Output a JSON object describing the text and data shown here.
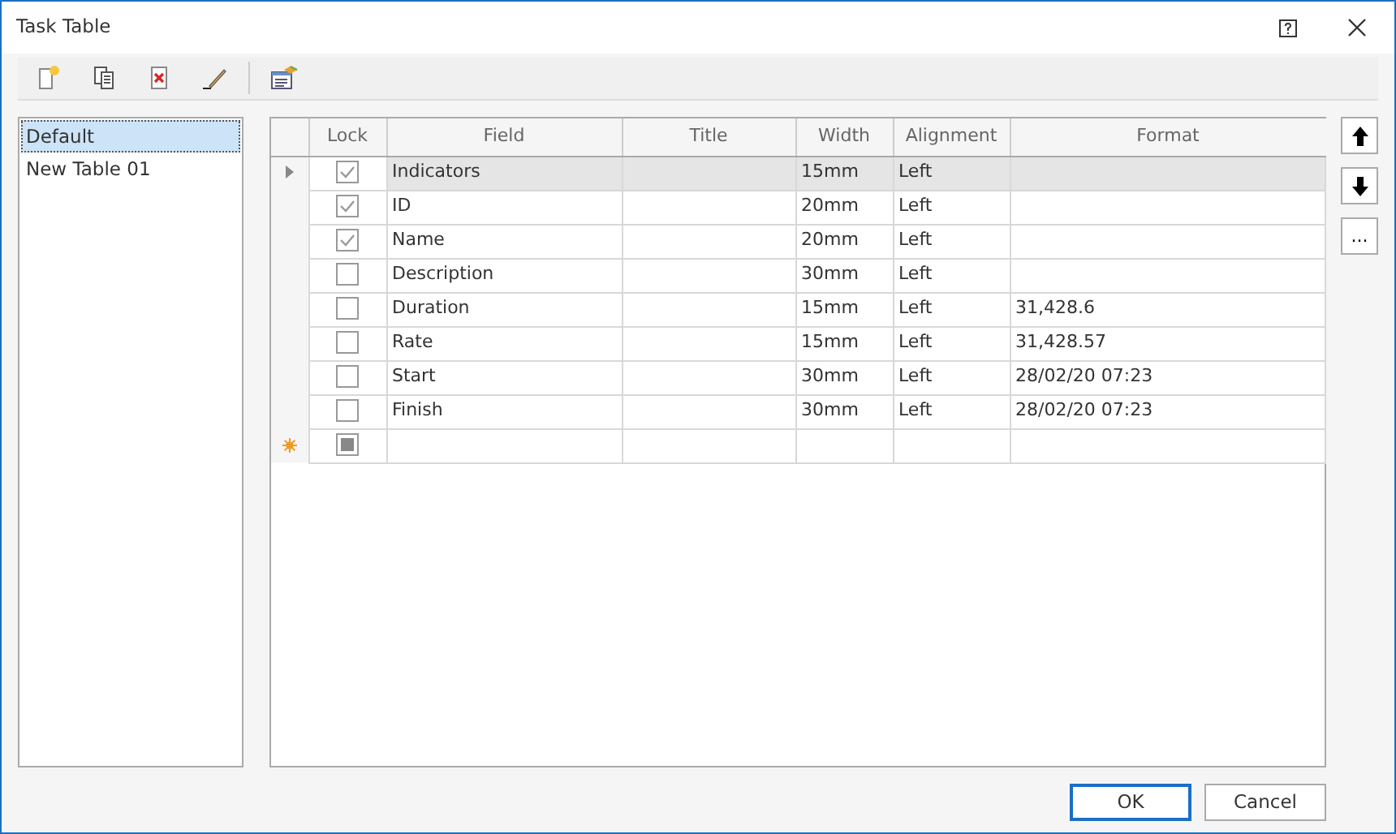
{
  "window": {
    "title": "Task Table"
  },
  "toolbar": [
    {
      "kind": "new"
    },
    {
      "kind": "copy"
    },
    {
      "kind": "delete"
    },
    {
      "kind": "rename"
    },
    {
      "kind": "properties"
    }
  ],
  "tables": [
    {
      "label": "Default",
      "selected": true
    },
    {
      "label": "New Table 01",
      "selected": false
    }
  ],
  "grid": {
    "columns": [
      "Lock",
      "Field",
      "Title",
      "Width",
      "Alignment",
      "Format"
    ],
    "rows": [
      {
        "kind": "row",
        "selected": true,
        "lock": true,
        "field": "Indicators",
        "width": "15mm",
        "alignment": "Left"
      },
      {
        "kind": "row",
        "selected": false,
        "lock": true,
        "field": "ID",
        "width": "20mm",
        "alignment": "Left"
      },
      {
        "kind": "row",
        "selected": false,
        "lock": true,
        "field": "Name",
        "width": "20mm",
        "alignment": "Left"
      },
      {
        "kind": "row",
        "selected": false,
        "lock": false,
        "field": "Description",
        "width": "30mm",
        "alignment": "Left"
      },
      {
        "kind": "row",
        "selected": false,
        "lock": false,
        "field": "Duration",
        "width": "15mm",
        "alignment": "Left",
        "format": "31,428.6"
      },
      {
        "kind": "row",
        "selected": false,
        "lock": false,
        "field": "Rate",
        "width": "15mm",
        "alignment": "Left",
        "format": "31,428.57"
      },
      {
        "kind": "row",
        "selected": false,
        "lock": false,
        "field": "Start",
        "width": "30mm",
        "alignment": "Left",
        "format": "28/02/20 07:23"
      },
      {
        "kind": "row",
        "selected": false,
        "lock": false,
        "field": "Finish",
        "width": "30mm",
        "alignment": "Left",
        "format": "28/02/20 07:23"
      },
      {
        "kind": "new",
        "selected": false,
        "indeterminate": true
      }
    ]
  },
  "side_buttons": [
    {
      "kind": "up"
    },
    {
      "kind": "down"
    },
    {
      "kind": "more",
      "label": "..."
    }
  ],
  "buttons": [
    {
      "label": "OK",
      "default": true
    },
    {
      "label": "Cancel",
      "default": false
    }
  ]
}
